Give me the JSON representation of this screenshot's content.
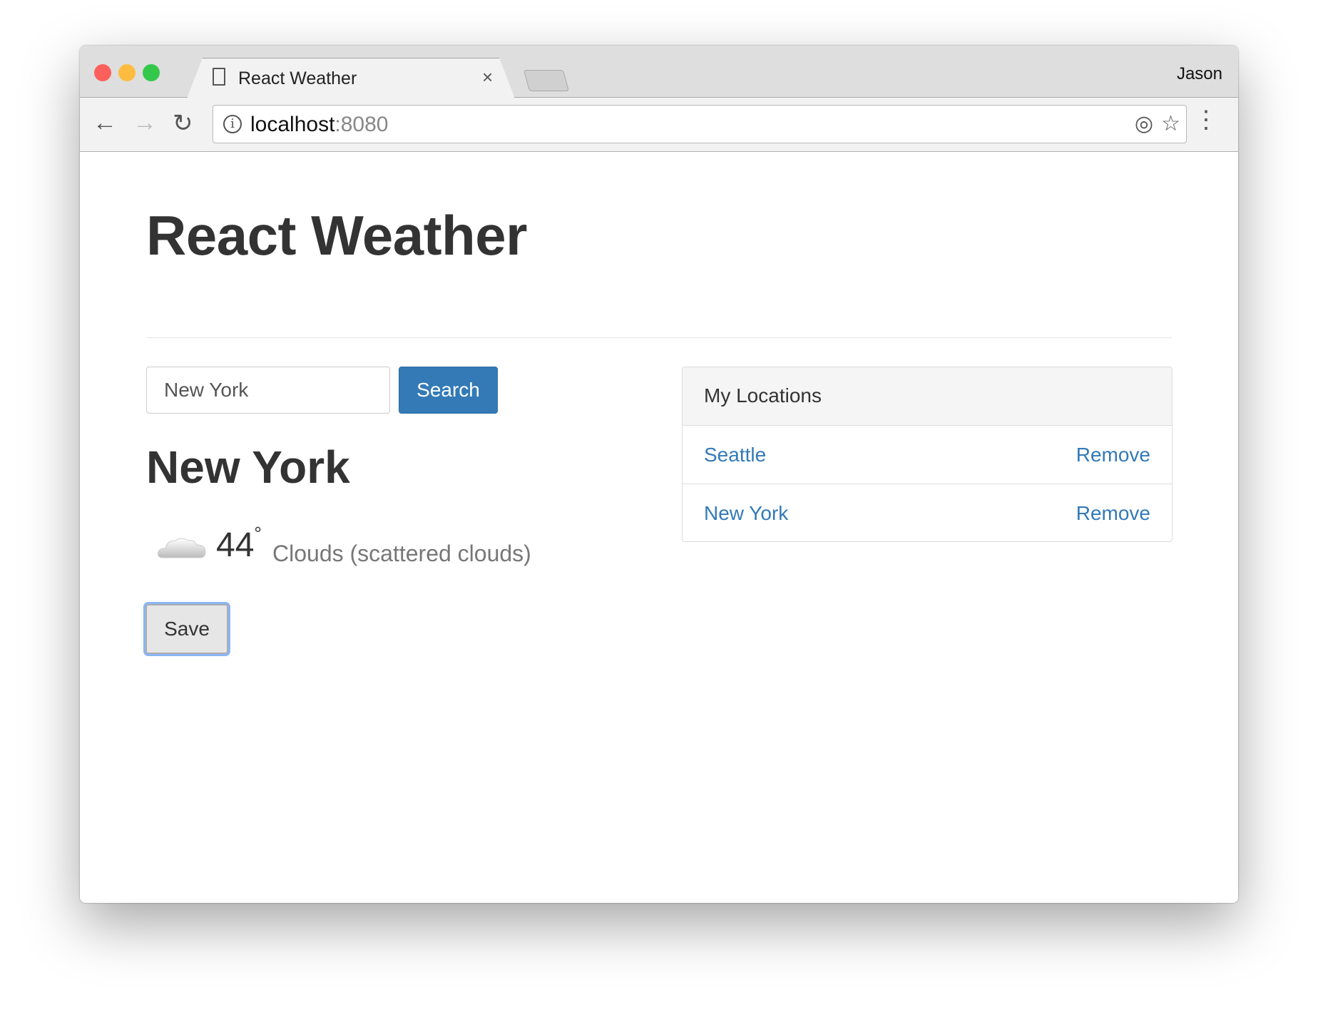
{
  "browser": {
    "tab_title": "React Weather",
    "tab_close": "×",
    "user": "Jason",
    "url_host": "localhost",
    "url_port": ":8080",
    "back": "←",
    "forward": "→",
    "reload": "↻",
    "info": "i",
    "locate": "◎",
    "bookmark": "☆",
    "menu": "⋮"
  },
  "page": {
    "title": "React Weather",
    "search": {
      "value": "New York",
      "button": "Search"
    },
    "city": "New York",
    "weather": {
      "icon": "cloud-icon",
      "temp": "44",
      "degree": "°",
      "description": "Clouds (scattered clouds)"
    },
    "save_label": "Save"
  },
  "locations": {
    "title": "My Locations",
    "items": [
      {
        "name": "Seattle",
        "action": "Remove"
      },
      {
        "name": "New York",
        "action": "Remove"
      }
    ]
  },
  "colors": {
    "link": "#337ab7",
    "primary": "#337ab7"
  }
}
